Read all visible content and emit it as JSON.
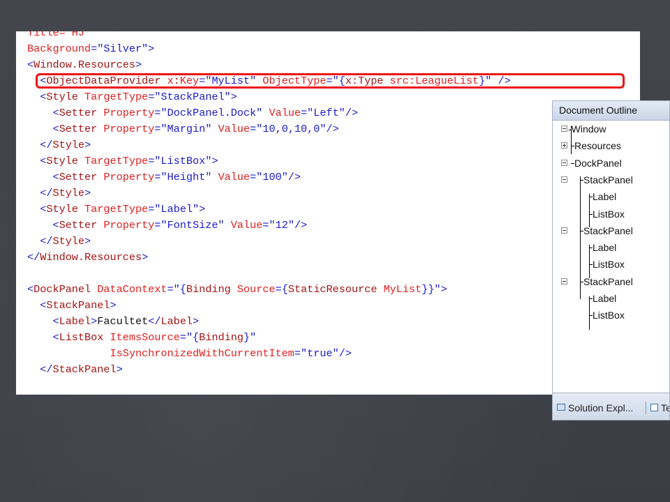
{
  "code": {
    "lines": [
      [
        {
          "c": "red",
          "t": "Title=\"HJ\""
        }
      ],
      [
        {
          "c": "red",
          "t": "Background"
        },
        {
          "c": "blue",
          "t": "=\"Silver\">"
        }
      ],
      [
        {
          "c": "blue",
          "t": "<"
        },
        {
          "c": "brown",
          "t": "Window.Resources"
        },
        {
          "c": "blue",
          "t": ">"
        }
      ],
      [
        {
          "c": "blue",
          "t": "  <"
        },
        {
          "c": "brown",
          "t": "ObjectDataProvider"
        },
        {
          "c": "red",
          "t": " x:Key"
        },
        {
          "c": "blue",
          "t": "=\"MyList\""
        },
        {
          "c": "red",
          "t": " ObjectType"
        },
        {
          "c": "blue",
          "t": "=\"{"
        },
        {
          "c": "brown",
          "t": "x:Type"
        },
        {
          "c": "red",
          "t": " src:LeagueList"
        },
        {
          "c": "blue",
          "t": "}\" />"
        }
      ],
      [
        {
          "c": "blue",
          "t": "  <"
        },
        {
          "c": "brown",
          "t": "Style"
        },
        {
          "c": "red",
          "t": " TargetType"
        },
        {
          "c": "blue",
          "t": "=\"StackPanel\">"
        }
      ],
      [
        {
          "c": "blue",
          "t": "    <"
        },
        {
          "c": "brown",
          "t": "Setter"
        },
        {
          "c": "red",
          "t": " Property"
        },
        {
          "c": "blue",
          "t": "=\"DockPanel.Dock\""
        },
        {
          "c": "red",
          "t": " Value"
        },
        {
          "c": "blue",
          "t": "=\"Left\"/>"
        }
      ],
      [
        {
          "c": "blue",
          "t": "    <"
        },
        {
          "c": "brown",
          "t": "Setter"
        },
        {
          "c": "red",
          "t": " Property"
        },
        {
          "c": "blue",
          "t": "=\"Margin\""
        },
        {
          "c": "red",
          "t": " Value"
        },
        {
          "c": "blue",
          "t": "=\"10,0,10,0\"/>"
        }
      ],
      [
        {
          "c": "blue",
          "t": "  </"
        },
        {
          "c": "brown",
          "t": "Style"
        },
        {
          "c": "blue",
          "t": ">"
        }
      ],
      [
        {
          "c": "blue",
          "t": "  <"
        },
        {
          "c": "brown",
          "t": "Style"
        },
        {
          "c": "red",
          "t": " TargetType"
        },
        {
          "c": "blue",
          "t": "=\"ListBox\">"
        }
      ],
      [
        {
          "c": "blue",
          "t": "    <"
        },
        {
          "c": "brown",
          "t": "Setter"
        },
        {
          "c": "red",
          "t": " Property"
        },
        {
          "c": "blue",
          "t": "=\"Height\""
        },
        {
          "c": "red",
          "t": " Value"
        },
        {
          "c": "blue",
          "t": "=\"100\"/>"
        }
      ],
      [
        {
          "c": "blue",
          "t": "  </"
        },
        {
          "c": "brown",
          "t": "Style"
        },
        {
          "c": "blue",
          "t": ">"
        }
      ],
      [
        {
          "c": "blue",
          "t": "  <"
        },
        {
          "c": "brown",
          "t": "Style"
        },
        {
          "c": "red",
          "t": " TargetType"
        },
        {
          "c": "blue",
          "t": "=\"Label\">"
        }
      ],
      [
        {
          "c": "blue",
          "t": "    <"
        },
        {
          "c": "brown",
          "t": "Setter"
        },
        {
          "c": "red",
          "t": " Property"
        },
        {
          "c": "blue",
          "t": "=\"FontSize\""
        },
        {
          "c": "red",
          "t": " Value"
        },
        {
          "c": "blue",
          "t": "=\"12\"/>"
        }
      ],
      [
        {
          "c": "blue",
          "t": "  </"
        },
        {
          "c": "brown",
          "t": "Style"
        },
        {
          "c": "blue",
          "t": ">"
        }
      ],
      [
        {
          "c": "blue",
          "t": "</"
        },
        {
          "c": "brown",
          "t": "Window.Resources"
        },
        {
          "c": "blue",
          "t": ">"
        }
      ],
      [
        {
          "c": "black",
          "t": ""
        }
      ],
      [
        {
          "c": "blue",
          "t": "<"
        },
        {
          "c": "brown",
          "t": "DockPanel"
        },
        {
          "c": "red",
          "t": " DataContext"
        },
        {
          "c": "blue",
          "t": "=\"{"
        },
        {
          "c": "brown",
          "t": "Binding"
        },
        {
          "c": "red",
          "t": " Source"
        },
        {
          "c": "blue",
          "t": "={"
        },
        {
          "c": "brown",
          "t": "StaticResource"
        },
        {
          "c": "red",
          "t": " MyList"
        },
        {
          "c": "blue",
          "t": "}}\">"
        }
      ],
      [
        {
          "c": "blue",
          "t": "  <"
        },
        {
          "c": "brown",
          "t": "StackPanel"
        },
        {
          "c": "blue",
          "t": ">"
        }
      ],
      [
        {
          "c": "blue",
          "t": "    <"
        },
        {
          "c": "brown",
          "t": "Label"
        },
        {
          "c": "blue",
          "t": ">"
        },
        {
          "c": "black",
          "t": "Facultet"
        },
        {
          "c": "blue",
          "t": "</"
        },
        {
          "c": "brown",
          "t": "Label"
        },
        {
          "c": "blue",
          "t": ">"
        }
      ],
      [
        {
          "c": "blue",
          "t": "    <"
        },
        {
          "c": "brown",
          "t": "ListBox"
        },
        {
          "c": "red",
          "t": " ItemsSource"
        },
        {
          "c": "blue",
          "t": "=\"{"
        },
        {
          "c": "brown",
          "t": "Binding"
        },
        {
          "c": "blue",
          "t": "}\""
        }
      ],
      [
        {
          "c": "red",
          "t": "             IsSynchronizedWithCurrentItem"
        },
        {
          "c": "blue",
          "t": "=\"true\"/>"
        }
      ],
      [
        {
          "c": "blue",
          "t": "  </"
        },
        {
          "c": "brown",
          "t": "StackPanel"
        },
        {
          "c": "blue",
          "t": ">"
        }
      ]
    ]
  },
  "outline": {
    "title": "Document Outline",
    "nodes": [
      {
        "label": "Window",
        "expander": "minus"
      },
      {
        "label": "Resources",
        "expander": "plus"
      },
      {
        "label": "DockPanel",
        "expander": "minus"
      },
      {
        "label": "StackPanel",
        "expander": "minus"
      },
      {
        "label": "Label",
        "expander": "none"
      },
      {
        "label": "ListBox",
        "expander": "none"
      },
      {
        "label": "StackPanel",
        "expander": "minus"
      },
      {
        "label": "Label",
        "expander": "none"
      },
      {
        "label": "ListBox",
        "expander": "none"
      },
      {
        "label": "StackPanel",
        "expander": "minus"
      },
      {
        "label": "Label",
        "expander": "none"
      },
      {
        "label": "ListBox",
        "expander": "none"
      }
    ],
    "footer": {
      "tab1": "Solution Expl...",
      "tab2": "Te"
    }
  },
  "colors": {
    "blue": "#1a1acc",
    "brown": "#a31515",
    "red": "#e02020",
    "highlight": "#ee1111",
    "background": "#3f4148"
  }
}
